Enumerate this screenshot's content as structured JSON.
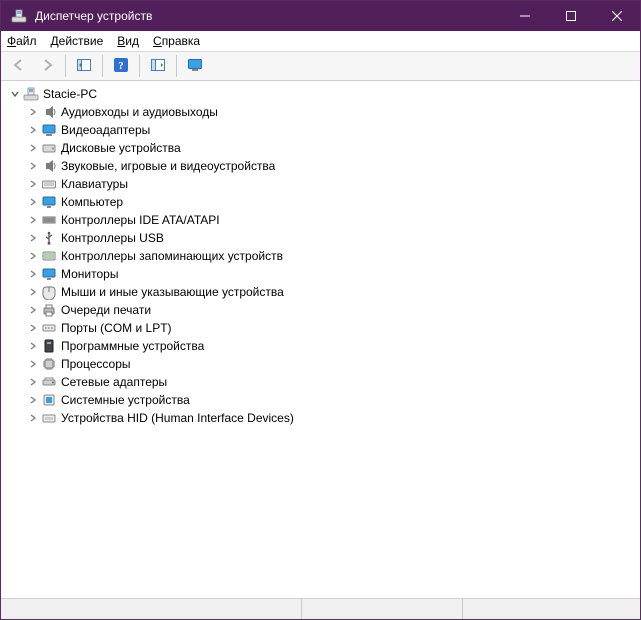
{
  "colors": {
    "titlebar_bg": "#51205b"
  },
  "window": {
    "title": "Диспетчер устройств"
  },
  "menu": {
    "file": {
      "pre": "",
      "u": "Ф",
      "post": "айл"
    },
    "action": {
      "pre": "",
      "u": "Д",
      "post": "ействие"
    },
    "view": {
      "pre": "",
      "u": "В",
      "post": "ид"
    },
    "help": {
      "pre": "",
      "u": "С",
      "post": "правка"
    }
  },
  "toolbar": {
    "back": {
      "icon": "arrow-left",
      "enabled": false
    },
    "forward": {
      "icon": "arrow-right",
      "enabled": false
    },
    "show_hidden": {
      "icon": "panel",
      "enabled": true
    },
    "help": {
      "icon": "help",
      "enabled": true
    },
    "scan": {
      "icon": "scan",
      "enabled": true
    },
    "monitor": {
      "icon": "monitor",
      "enabled": true
    }
  },
  "tree": {
    "root": {
      "label": "Stacie-PC",
      "icon": "computer",
      "expanded": true
    },
    "categories": [
      {
        "label": "Аудиовходы и аудиовыходы",
        "icon": "audio"
      },
      {
        "label": "Видеоадаптеры",
        "icon": "display"
      },
      {
        "label": "Дисковые устройства",
        "icon": "disk"
      },
      {
        "label": "Звуковые, игровые и видеоустройства",
        "icon": "audio"
      },
      {
        "label": "Клавиатуры",
        "icon": "keyboard"
      },
      {
        "label": "Компьютер",
        "icon": "monitor-sm"
      },
      {
        "label": "Контроллеры IDE ATA/ATAPI",
        "icon": "ide"
      },
      {
        "label": "Контроллеры USB",
        "icon": "usb"
      },
      {
        "label": "Контроллеры запоминающих устройств",
        "icon": "storage"
      },
      {
        "label": "Мониторы",
        "icon": "monitor-sm"
      },
      {
        "label": "Мыши и иные указывающие устройства",
        "icon": "mouse"
      },
      {
        "label": "Очереди печати",
        "icon": "printer"
      },
      {
        "label": "Порты (COM и LPT)",
        "icon": "port"
      },
      {
        "label": "Программные устройства",
        "icon": "software"
      },
      {
        "label": "Процессоры",
        "icon": "cpu"
      },
      {
        "label": "Сетевые адаптеры",
        "icon": "network"
      },
      {
        "label": "Системные устройства",
        "icon": "system"
      },
      {
        "label": "Устройства HID (Human Interface Devices)",
        "icon": "hid"
      }
    ]
  }
}
